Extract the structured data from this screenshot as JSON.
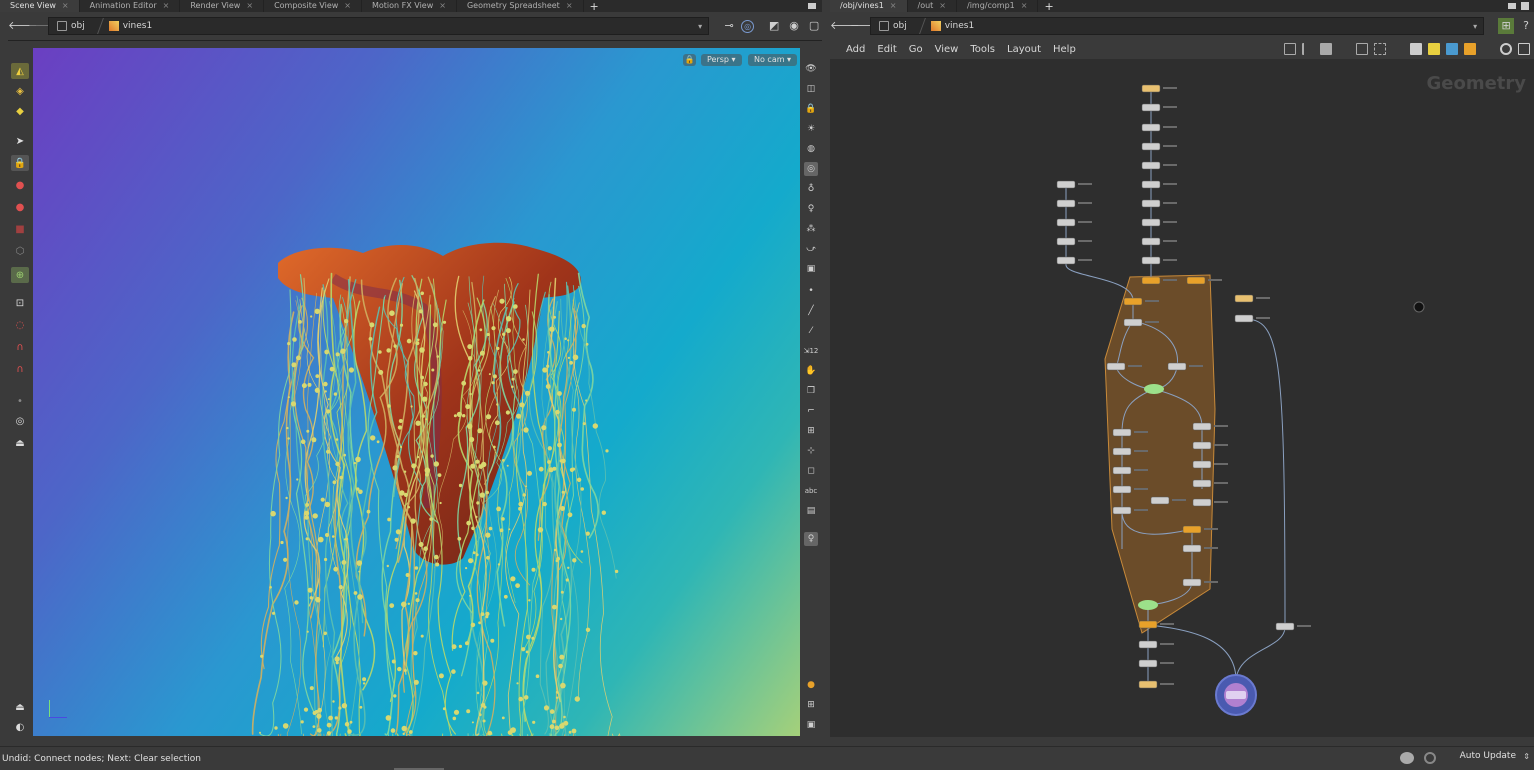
{
  "left_tabs": [
    "Scene View",
    "Animation Editor",
    "Render View",
    "Composite View",
    "Motion FX View",
    "Geometry Spreadsheet"
  ],
  "right_tabs": [
    "/obj/vines1",
    "/out",
    "/img/comp1"
  ],
  "tab_close": "×",
  "tab_add": "+",
  "left_path": {
    "obj": "obj",
    "node": "vines1"
  },
  "right_path": {
    "obj": "obj",
    "node": "vines1"
  },
  "viewport": {
    "lock": "🔒",
    "camera_view": "Persp ▾",
    "cam": "No cam ▾"
  },
  "menu": [
    "Add",
    "Edit",
    "Go",
    "View",
    "Tools",
    "Layout",
    "Help"
  ],
  "network_label": "Geometry",
  "status": {
    "message": "Undid: Connect nodes; Next: Clear selection",
    "auto_update": "Auto Update"
  },
  "icons": {
    "back": "back-arrow-icon",
    "forward": "forward-arrow-icon"
  },
  "colors": {
    "accent": "#e8a12a",
    "selected_group": "#a86a24",
    "viewport_start": "#6b3fc2",
    "viewport_end": "#a5d07a"
  }
}
